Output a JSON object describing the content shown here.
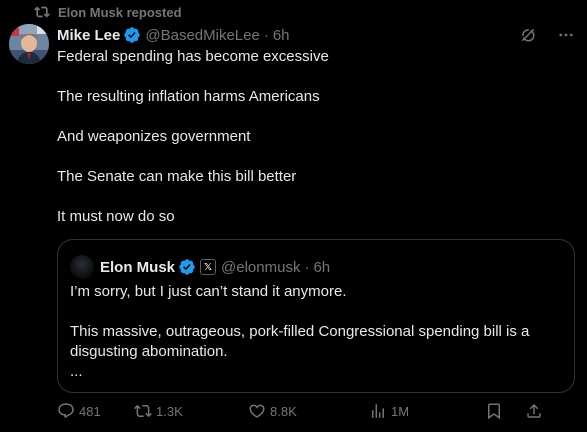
{
  "repost": {
    "text": "Elon Musk reposted"
  },
  "tweet": {
    "author_name": "Mike Lee",
    "author_handle": "@BasedMikeLee",
    "separator": "·",
    "time": "6h",
    "lines": [
      "Federal spending has become excessive",
      "The resulting inflation harms Americans",
      "And weaponizes government",
      "The Senate can make this bill better",
      "It must now do so"
    ]
  },
  "quote": {
    "author_name": "Elon Musk",
    "badge": "𝕏",
    "author_handle": "@elonmusk",
    "separator": "·",
    "time": "6h",
    "paragraph1": "I’m sorry, but I just can’t stand it anymore.",
    "paragraph2": "This massive, outrageous, pork-filled Congressional spending bill is a disgusting abomination.",
    "ellipsis": "..."
  },
  "actions": {
    "replies": "481",
    "reposts": "1.3K",
    "likes": "8.8K",
    "views": "1M"
  },
  "colors": {
    "background": "#000000",
    "text": "#e7e9ea",
    "muted": "#71767b",
    "border": "#2f3336",
    "verified": "#1d9bf0"
  },
  "icons": [
    "repost-icon",
    "verified-badge-icon",
    "grok-icon",
    "more-icon",
    "reply-icon",
    "retweet-icon",
    "like-icon",
    "views-icon",
    "bookmark-icon",
    "share-icon"
  ]
}
